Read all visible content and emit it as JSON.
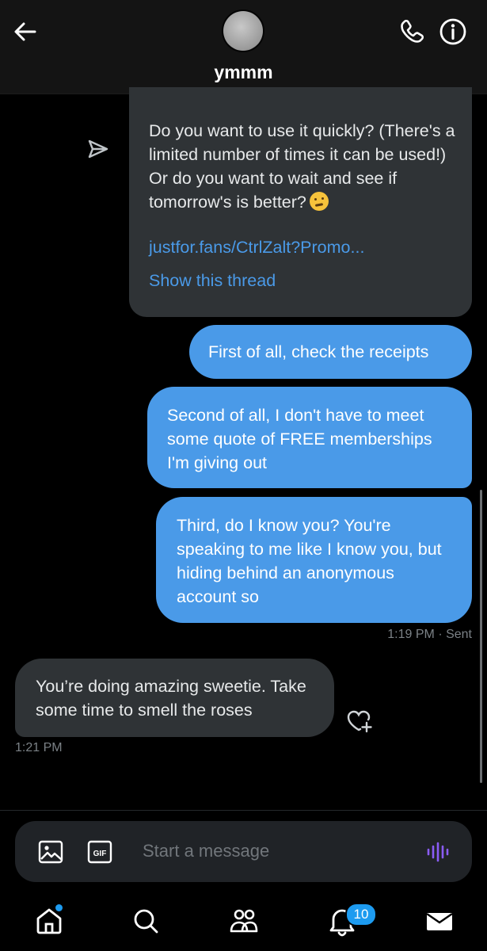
{
  "header": {
    "title": "ymmm"
  },
  "shared_post": {
    "text": "Do you want to use it quickly? (There's a limited number of times it can be used!) Or do you want to wait and see if tomorrow's is better?",
    "emoji": "thinking-face",
    "link": "justfor.fans/CtrlZalt?Promo...",
    "show_thread": "Show this thread"
  },
  "sent_messages": [
    {
      "text": "First of all, check the receipts"
    },
    {
      "text": "Second of all, I don't have to meet some quote of FREE memberships I'm giving out"
    },
    {
      "text": "Third, do I know you? You're speaking to me like I know you, but hiding behind an anonymous account so"
    }
  ],
  "sent_meta": "1:19 PM · Sent",
  "received_message": {
    "text": "You’re doing amazing sweetie. Take some time to smell the roses",
    "time": "1:21 PM"
  },
  "composer": {
    "placeholder": "Start a message",
    "gif_label": "GIF"
  },
  "bottom_nav": {
    "notifications_badge": "10"
  },
  "colors": {
    "accent": "#4a9ae8",
    "badge": "#1d9bf0",
    "received_bubble": "#2f3336",
    "voice_icon": "#8a5cf6"
  }
}
